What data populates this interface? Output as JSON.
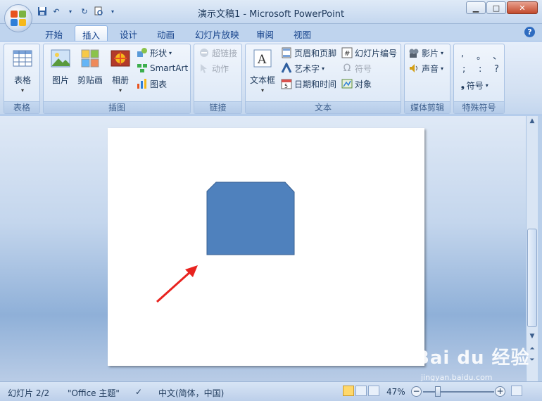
{
  "window": {
    "title": "演示文稿1 - Microsoft PowerPoint"
  },
  "tabs": [
    "开始",
    "插入",
    "设计",
    "动画",
    "幻灯片放映",
    "审阅",
    "视图"
  ],
  "active_tab": "插入",
  "ribbon": {
    "groups": {
      "tables": {
        "label": "表格",
        "table_btn": "表格"
      },
      "illustrations": {
        "label": "插图",
        "picture": "图片",
        "clipart": "剪贴画",
        "album": "相册",
        "shapes": "形状",
        "smartart": "SmartArt",
        "chart": "图表"
      },
      "links": {
        "label": "链接",
        "hyperlink": "超链接",
        "action": "动作"
      },
      "text": {
        "label": "文本",
        "textbox": "文本框",
        "header_footer": "页眉和页脚",
        "wordart": "艺术字",
        "datetime": "日期和时间",
        "slide_number": "幻灯片编号",
        "symbol": "符号",
        "object": "对象"
      },
      "media": {
        "label": "媒体剪辑",
        "movie": "影片",
        "sound": "声音"
      },
      "special": {
        "label": "特殊符号",
        "row1": [
          ",",
          "。",
          "、"
        ],
        "row2": [
          ";",
          ":",
          "?"
        ],
        "symbol_btn": "符号"
      }
    }
  },
  "status": {
    "slide_info": "幻灯片 2/2",
    "theme": "\"Office 主题\"",
    "language": "中文(简体，中国)",
    "zoom": "47%",
    "zoom_minus": "−",
    "zoom_plus": "+"
  },
  "watermark": {
    "brand": "Bai du 经验",
    "url": "jingyan.baidu.com"
  },
  "colors": {
    "shape_fill": "#4f81bd",
    "shape_stroke": "#3a6193",
    "arrow": "#e8231f",
    "accent": "#15428b"
  }
}
